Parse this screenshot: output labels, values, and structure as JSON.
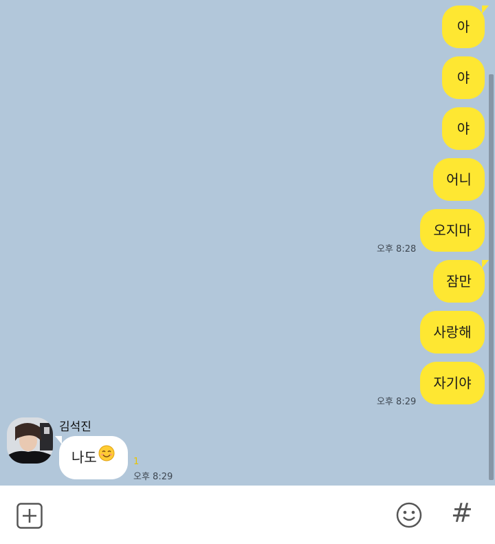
{
  "messages_out": [
    {
      "text": "아",
      "time": ""
    },
    {
      "text": "야",
      "time": ""
    },
    {
      "text": "야",
      "time": ""
    },
    {
      "text": "어니",
      "time": ""
    },
    {
      "text": "오지마",
      "time": "오후 8:28"
    },
    {
      "text": "잠만",
      "time": ""
    },
    {
      "text": "사랑해",
      "time": ""
    },
    {
      "text": "자기야",
      "time": "오후 8:29"
    }
  ],
  "incoming": {
    "sender": "김석진",
    "text": "나도",
    "emoji": "smiling-face-emoji",
    "unread_count": "1",
    "time": "오후 8:29"
  },
  "input_bar": {
    "add_icon": "plus-square-icon",
    "emoji_icon": "smiley-icon",
    "hash_icon": "hashtag-icon",
    "hash_glyph": "#"
  },
  "colors": {
    "chat_background": "#b2c7da",
    "outgoing_bubble": "#fee732",
    "incoming_bubble": "#ffffff",
    "unread_count": "#e8c400"
  }
}
